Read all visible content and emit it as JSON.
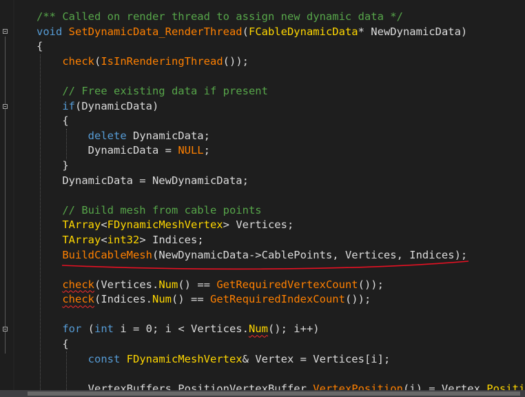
{
  "editor": {
    "lines": [
      [
        {
          "t": "/** Called on render thread to assign new dynamic data */",
          "c": "cm"
        }
      ],
      [
        {
          "t": "void",
          "c": "kw"
        },
        {
          "t": " ",
          "c": "id"
        },
        {
          "t": "SetDynamicData_RenderThread",
          "c": "fn"
        },
        {
          "t": "(",
          "c": "id"
        },
        {
          "t": "FCableDynamicData",
          "c": "ty"
        },
        {
          "t": "* NewDynamicData)",
          "c": "id"
        }
      ],
      [
        {
          "t": "{",
          "c": "id"
        }
      ],
      [
        {
          "t": "    ",
          "c": "id"
        },
        {
          "t": "check",
          "c": "fn"
        },
        {
          "t": "(",
          "c": "id"
        },
        {
          "t": "IsInRenderingThread",
          "c": "fn"
        },
        {
          "t": "());",
          "c": "id"
        }
      ],
      [
        {
          "t": "",
          "c": "id"
        }
      ],
      [
        {
          "t": "    ",
          "c": "id"
        },
        {
          "t": "// Free existing data if present",
          "c": "cm"
        }
      ],
      [
        {
          "t": "    ",
          "c": "id"
        },
        {
          "t": "if",
          "c": "kw"
        },
        {
          "t": "(DynamicData)",
          "c": "id"
        }
      ],
      [
        {
          "t": "    {",
          "c": "id"
        }
      ],
      [
        {
          "t": "        ",
          "c": "id"
        },
        {
          "t": "delete",
          "c": "kw"
        },
        {
          "t": " DynamicData;",
          "c": "id"
        }
      ],
      [
        {
          "t": "        DynamicData = ",
          "c": "id"
        },
        {
          "t": "NULL",
          "c": "fn"
        },
        {
          "t": ";",
          "c": "id"
        }
      ],
      [
        {
          "t": "    }",
          "c": "id"
        }
      ],
      [
        {
          "t": "    DynamicData = NewDynamicData;",
          "c": "id"
        }
      ],
      [
        {
          "t": "",
          "c": "id"
        }
      ],
      [
        {
          "t": "    ",
          "c": "id"
        },
        {
          "t": "// Build mesh from cable points",
          "c": "cm"
        }
      ],
      [
        {
          "t": "    ",
          "c": "id"
        },
        {
          "t": "TArray",
          "c": "ty"
        },
        {
          "t": "<",
          "c": "id"
        },
        {
          "t": "FDynamicMeshVertex",
          "c": "ty"
        },
        {
          "t": "> Vertices;",
          "c": "id"
        }
      ],
      [
        {
          "t": "    ",
          "c": "id"
        },
        {
          "t": "TArray",
          "c": "ty"
        },
        {
          "t": "<",
          "c": "id"
        },
        {
          "t": "int32",
          "c": "ty"
        },
        {
          "t": "> Indices;",
          "c": "id"
        }
      ],
      [
        {
          "t": "    ",
          "c": "id"
        },
        {
          "t": "BuildCableMesh",
          "c": "fn"
        },
        {
          "t": "(NewDynamicData->CablePoints, Vertices, Indices);",
          "c": "id"
        }
      ],
      [
        {
          "t": "",
          "c": "id"
        }
      ],
      [
        {
          "t": "    ",
          "c": "id"
        },
        {
          "t": "check",
          "c": "fn",
          "sq": true
        },
        {
          "t": "(Vertices.",
          "c": "id"
        },
        {
          "t": "Num",
          "c": "ty"
        },
        {
          "t": "() == ",
          "c": "id"
        },
        {
          "t": "GetRequiredVertexCount",
          "c": "fn"
        },
        {
          "t": "());",
          "c": "id"
        }
      ],
      [
        {
          "t": "    ",
          "c": "id"
        },
        {
          "t": "check",
          "c": "fn",
          "sq": true
        },
        {
          "t": "(Indices.",
          "c": "id"
        },
        {
          "t": "Num",
          "c": "ty"
        },
        {
          "t": "() == ",
          "c": "id"
        },
        {
          "t": "GetRequiredIndexCount",
          "c": "fn"
        },
        {
          "t": "());",
          "c": "id"
        }
      ],
      [
        {
          "t": "",
          "c": "id"
        }
      ],
      [
        {
          "t": "    ",
          "c": "id"
        },
        {
          "t": "for",
          "c": "kw"
        },
        {
          "t": " (",
          "c": "id"
        },
        {
          "t": "int",
          "c": "kw"
        },
        {
          "t": " i = 0; i < Vertices.",
          "c": "id"
        },
        {
          "t": "Num",
          "c": "ty",
          "sq": true
        },
        {
          "t": "(); i++)",
          "c": "id"
        }
      ],
      [
        {
          "t": "    {",
          "c": "id"
        }
      ],
      [
        {
          "t": "        ",
          "c": "id"
        },
        {
          "t": "const",
          "c": "kw"
        },
        {
          "t": " ",
          "c": "id"
        },
        {
          "t": "FDynamicMeshVertex",
          "c": "ty"
        },
        {
          "t": "& Vertex = Vertices[i];",
          "c": "id"
        }
      ],
      [
        {
          "t": "",
          "c": "id"
        }
      ],
      [
        {
          "t": "        VertexBuffers.PositionVertexBuffer.",
          "c": "id"
        },
        {
          "t": "VertexPosition",
          "c": "fn"
        },
        {
          "t": "(i) = Vertex.",
          "c": "id"
        },
        {
          "t": "Positi",
          "c": "ty"
        }
      ]
    ]
  }
}
